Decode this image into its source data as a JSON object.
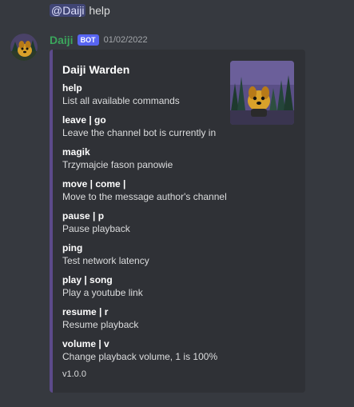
{
  "previous_message": {
    "mention": "@Daiji",
    "text": " help"
  },
  "message": {
    "author": "Daiji",
    "bot_tag": "BOT",
    "timestamp": "01/02/2022",
    "avatar_icon": "dog-avatar-icon",
    "embed": {
      "title": "Daiji Warden",
      "accent_color": "#5c4a8a",
      "thumbnail_icon": "dog-in-forest-thumbnail",
      "fields": [
        {
          "name": "help",
          "value": "List all available commands"
        },
        {
          "name": "leave | go",
          "value": "Leave the channel bot is currently in"
        },
        {
          "name": "magik",
          "value": "Trzymajcie fason panowie"
        },
        {
          "name": "move | come |",
          "value": "Move to the message author's channel"
        },
        {
          "name": "pause | p",
          "value": "Pause playback"
        },
        {
          "name": "ping",
          "value": "Test network latency"
        },
        {
          "name": "play | song",
          "value": "Play a youtube link"
        },
        {
          "name": "resume | r",
          "value": "Resume playback"
        },
        {
          "name": "volume | v",
          "value": "Change playback volume, 1 is 100%"
        }
      ],
      "footer": "v1.0.0"
    }
  }
}
